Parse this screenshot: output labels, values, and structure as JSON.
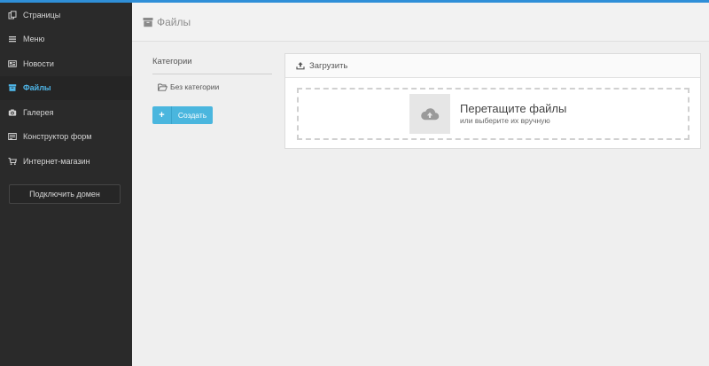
{
  "sidebar": {
    "items": [
      {
        "label": "Страницы",
        "icon": "pages-icon",
        "active": false
      },
      {
        "label": "Меню",
        "icon": "menu-icon",
        "active": false
      },
      {
        "label": "Новости",
        "icon": "news-icon",
        "active": false
      },
      {
        "label": "Файлы",
        "icon": "files-icon",
        "active": true
      },
      {
        "label": "Галерея",
        "icon": "camera-icon",
        "active": false
      },
      {
        "label": "Конструктор форм",
        "icon": "form-builder-icon",
        "active": false
      },
      {
        "label": "Интернет-магазин",
        "icon": "cart-icon",
        "active": false
      }
    ],
    "domain_button": "Подключить домен"
  },
  "header": {
    "title": "Файлы",
    "icon": "archive-icon"
  },
  "categories": {
    "title": "Категории",
    "items": [
      {
        "label": "Без категории",
        "icon": "folder-open-icon"
      }
    ],
    "create_button": "Создать"
  },
  "upload": {
    "header": "Загрузить",
    "drop_title": "Перетащите файлы",
    "drop_subtitle": "или выберите их вручную",
    "icon": "cloud-upload-icon"
  },
  "colors": {
    "accent": "#4fb6e8",
    "sidebar_bg": "#2a2a2a",
    "button_bg": "#4ab6de",
    "topbar": "#2f8fd8"
  }
}
